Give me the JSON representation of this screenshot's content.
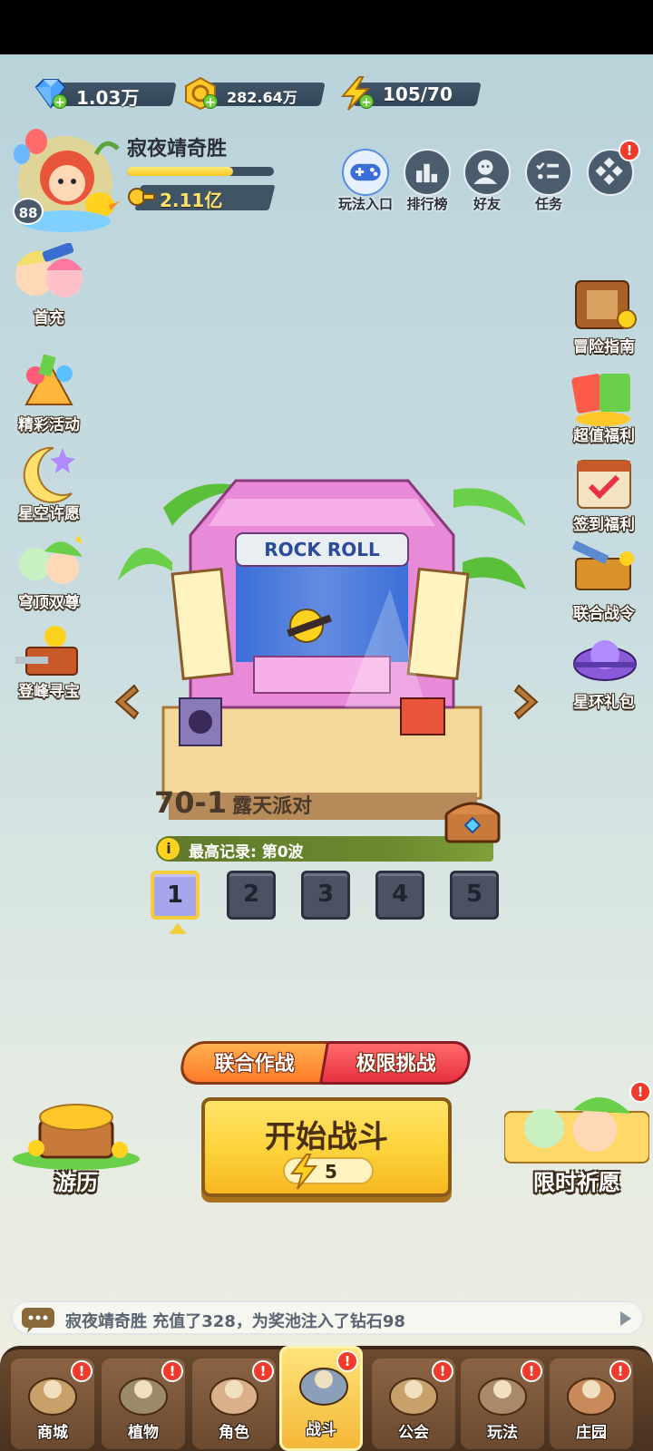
{
  "resources": {
    "gems": "1.03万",
    "coins": "282.64万",
    "energy": "105/70"
  },
  "player": {
    "name": "寂夜靖奇胜",
    "level": "88",
    "power": "2.11亿",
    "xp_progress": 0.72
  },
  "top_buttons": [
    {
      "label": "玩法入口",
      "icon": "gamepad-icon"
    },
    {
      "label": "排行榜",
      "icon": "leaderboard-icon"
    },
    {
      "label": "好友",
      "icon": "friends-icon"
    },
    {
      "label": "任务",
      "icon": "task-list-icon"
    },
    {
      "label": "",
      "icon": "more-menu-icon",
      "alert": "!"
    }
  ],
  "left_menu": [
    {
      "label": "首充"
    },
    {
      "label": "精彩活动"
    },
    {
      "label": "星空许愿"
    },
    {
      "label": "穹顶双尊"
    },
    {
      "label": "登峰寻宝"
    }
  ],
  "right_menu": [
    {
      "label": "冒险指南"
    },
    {
      "label": "超值福利"
    },
    {
      "label": "签到福利"
    },
    {
      "label": "联合战令"
    },
    {
      "label": "星环礼包"
    }
  ],
  "stage": {
    "number": "70-1",
    "name": "露天派对",
    "sign_text": "ROCK ROLL",
    "record_label": "最高记录: 第0波",
    "waves": [
      "1",
      "2",
      "3",
      "4",
      "5"
    ],
    "selected_wave": "1"
  },
  "modes": {
    "coop": "联合作战",
    "challenge": "极限挑战"
  },
  "start": {
    "label": "开始战斗",
    "cost": "5"
  },
  "corners": {
    "left": "游历",
    "right": "限时祈愿",
    "right_alert": "!"
  },
  "marquee": "寂夜靖奇胜 充值了328，为奖池注入了钻石98",
  "nav": [
    {
      "label": "商城",
      "alert": "!"
    },
    {
      "label": "植物",
      "alert": "!"
    },
    {
      "label": "角色",
      "alert": "!"
    },
    {
      "label": "战斗",
      "alert": "!",
      "active": true
    },
    {
      "label": "公会",
      "alert": "!"
    },
    {
      "label": "玩法",
      "alert": "!"
    },
    {
      "label": "庄园",
      "alert": "!"
    }
  ],
  "colors": {
    "sky_top": "#b9d3db",
    "start_button": "#fdd23a",
    "coop_tab": "#ff9a3c",
    "challenge_tab": "#ef4050",
    "nav_bg": "#5a3d26",
    "alert": "#ef3b2c"
  }
}
